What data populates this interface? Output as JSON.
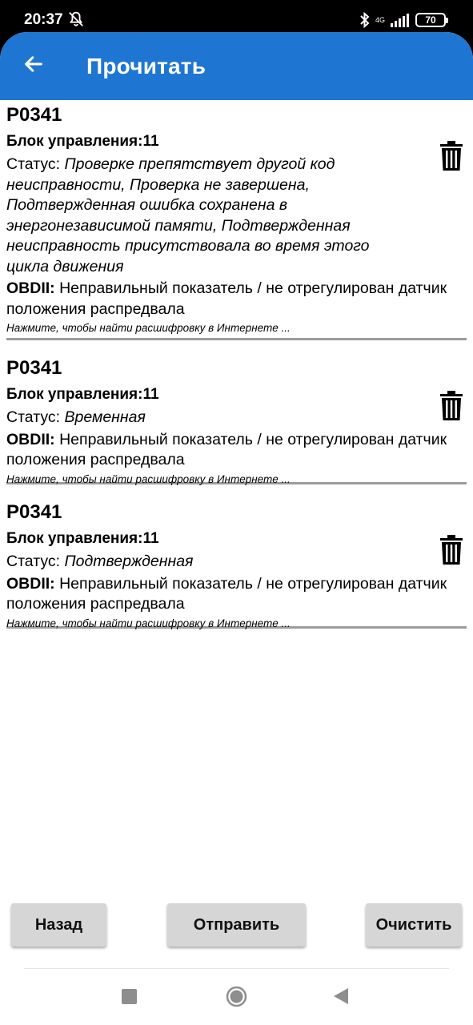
{
  "status_bar": {
    "time": "20:37",
    "network": "4G",
    "battery": "70"
  },
  "app_bar": {
    "title": "Прочитать"
  },
  "dtc_list": [
    {
      "code": "P0341",
      "ecu": "Блок управления:11",
      "status_label": "Статус: ",
      "status_value": "Проверке препятствует другой код неисправности, Проверка не завершена, Подтвержденная ошибка сохранена в энергонезависимой памяти, Подтвержденная неисправность присутствовала во время этого цикла движения",
      "obd_label": "OBDII:",
      "obd_text": " Неправильный показатель / не отрегулирован датчик положения распредвала",
      "hint": "Нажмите, чтобы найти расшифровку в Интернете ..."
    },
    {
      "code": "P0341",
      "ecu": "Блок управления:11",
      "status_label": "Статус: ",
      "status_value": "Временная",
      "obd_label": "OBDII:",
      "obd_text": " Неправильный показатель / не отрегулирован датчик положения распредвала",
      "hint": "Нажмите, чтобы найти расшифровку в Интернете ..."
    },
    {
      "code": "P0341",
      "ecu": "Блок управления:11",
      "status_label": "Статус: ",
      "status_value": "Подтвержденная",
      "obd_label": "OBDII:",
      "obd_text": " Неправильный показатель / не отрегулирован датчик положения распредвала",
      "hint": "Нажмите, чтобы найти расшифровку в Интернете ..."
    }
  ],
  "buttons": {
    "back": "Назад",
    "send": "Отправить",
    "clear": "Очистить"
  },
  "colors": {
    "app_bar": "#1e76d2",
    "button_bg": "#d6d6d6",
    "divider": "#9c9c9c"
  },
  "icons": {
    "back": "arrow-left-icon",
    "delete": "trash-icon",
    "nav_recents": "square-icon",
    "nav_home": "circle-icon",
    "nav_back": "triangle-icon"
  }
}
